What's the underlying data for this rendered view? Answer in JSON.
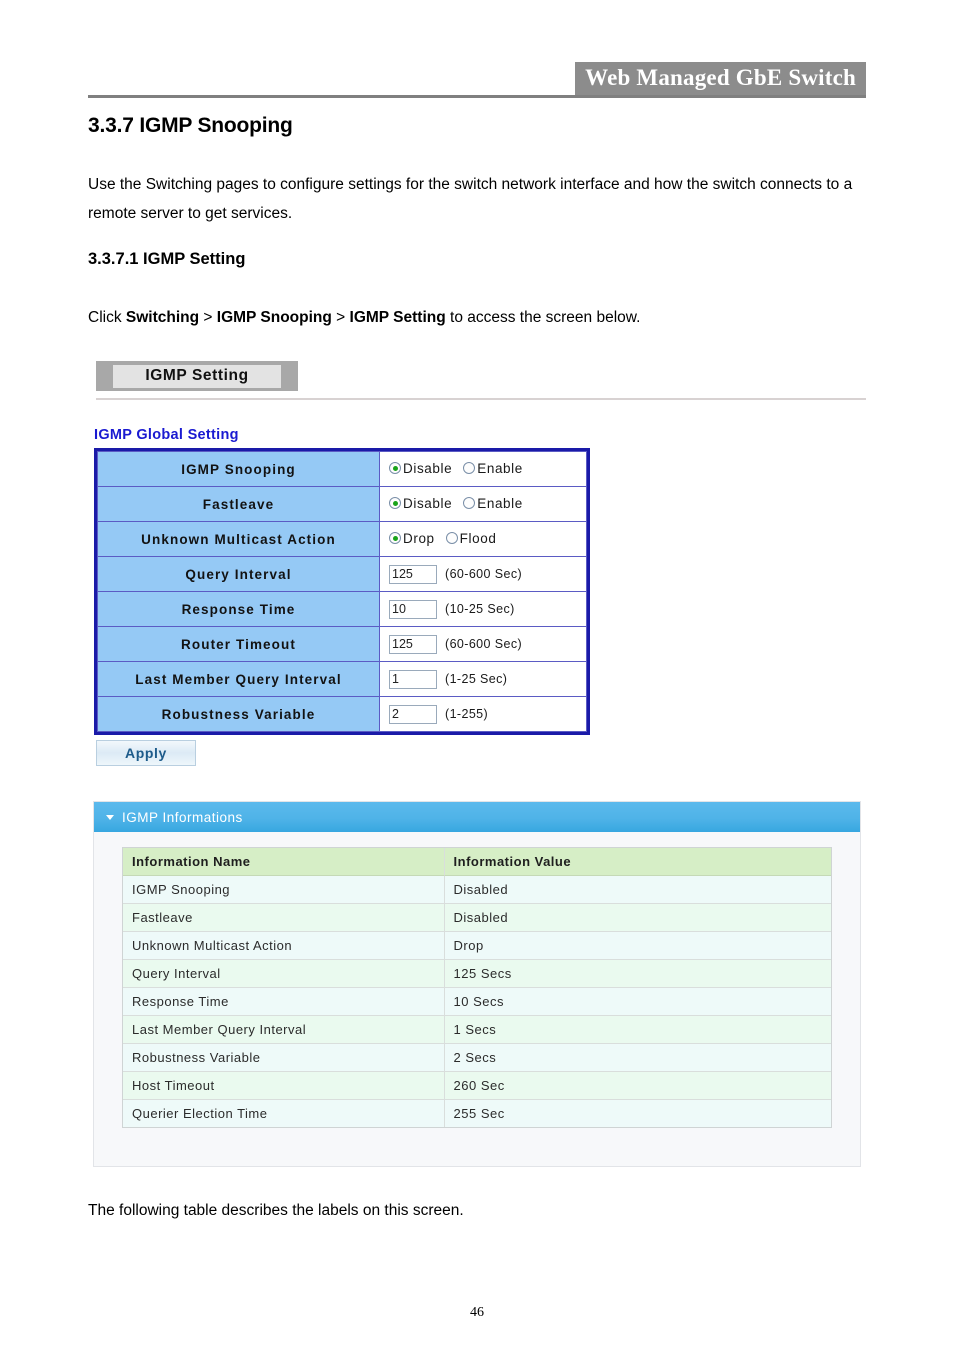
{
  "header": {
    "title": "Web Managed GbE Switch"
  },
  "document": {
    "section_number_title": "3.3.7 IGMP Snooping",
    "intro_paragraph": "Use the Switching pages to configure settings for the switch network interface and how the switch connects to a remote server to get services.",
    "subsection_title": "3.3.7.1 IGMP Setting",
    "click_path_prefix": "Click ",
    "click_path_1": "Switching",
    "click_sep_1": " > ",
    "click_path_2": "IGMP Snooping",
    "click_sep_2": " > ",
    "click_path_3": "IGMP Setting",
    "click_path_suffix": " to access the screen below.",
    "following_paragraph": "The following table describes the labels on this screen.",
    "page_number": "46"
  },
  "screen": {
    "tab_label": "IGMP Setting",
    "global_setting_label": "IGMP Global Setting",
    "apply_label": "Apply",
    "settings_rows": [
      {
        "name": "IGMP Snooping",
        "type": "radio",
        "options": [
          {
            "label": "Disable",
            "checked": true
          },
          {
            "label": "Enable",
            "checked": false
          }
        ]
      },
      {
        "name": "Fastleave",
        "type": "radio",
        "options": [
          {
            "label": "Disable",
            "checked": true
          },
          {
            "label": "Enable",
            "checked": false
          }
        ]
      },
      {
        "name": "Unknown Multicast Action",
        "type": "radio",
        "options": [
          {
            "label": "Drop",
            "checked": true
          },
          {
            "label": "Flood",
            "checked": false
          }
        ]
      },
      {
        "name": "Query Interval",
        "type": "input",
        "value": "125",
        "hint": "(60-600 Sec)"
      },
      {
        "name": "Response Time",
        "type": "input",
        "value": "10",
        "hint": "(10-25 Sec)"
      },
      {
        "name": "Router Timeout",
        "type": "input",
        "value": "125",
        "hint": "(60-600 Sec)"
      },
      {
        "name": "Last Member Query Interval",
        "type": "input",
        "value": "1",
        "hint": "(1-25 Sec)"
      },
      {
        "name": "Robustness Variable",
        "type": "input",
        "value": "2",
        "hint": "(1-255)"
      }
    ],
    "info_panel": {
      "title": "IGMP Informations",
      "columns": [
        "Information Name",
        "Information Value"
      ],
      "rows": [
        [
          "IGMP Snooping",
          "Disabled"
        ],
        [
          "Fastleave",
          "Disabled"
        ],
        [
          "Unknown Multicast Action",
          "Drop"
        ],
        [
          "Query Interval",
          "125 Secs"
        ],
        [
          "Response Time",
          "10 Secs"
        ],
        [
          "Last Member Query Interval",
          "1 Secs"
        ],
        [
          "Robustness Variable",
          "2 Secs"
        ],
        [
          "Host Timeout",
          "260 Sec"
        ],
        [
          "Querier Election Time",
          "255 Sec"
        ]
      ]
    }
  },
  "colors": {
    "header_bg": "#8c8c8c",
    "table_header_blue": "#95c9f5",
    "table_border_blue": "#1a1aa8",
    "panel_header_blue": "#4fb3e8",
    "info_header_green": "#d6eec6",
    "radio_dot_green": "#19a319"
  }
}
